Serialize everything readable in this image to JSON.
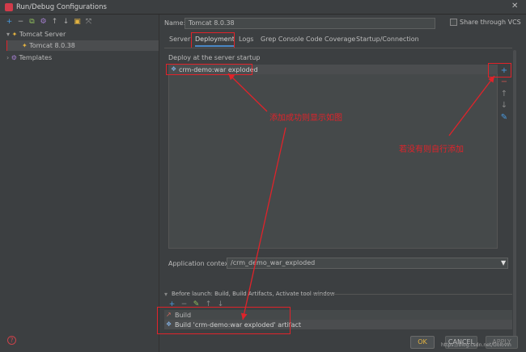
{
  "window": {
    "title": "Run/Debug Configurations",
    "close_glyph": "✕"
  },
  "left_toolbar": [
    "+",
    "−",
    "⧉",
    "⚙",
    "↑",
    "↓",
    "▣",
    "⤧"
  ],
  "tree": {
    "group_label": "Tomcat Server",
    "item_label": "Tomcat 8.0.38",
    "templates_label": "Templates"
  },
  "form": {
    "name_label": "Name:",
    "name_value": "Tomcat 8.0.38",
    "share_label": "Share through VCS"
  },
  "tabs": [
    "Server",
    "Deployment",
    "Logs",
    "Grep Console",
    "Code Coverage",
    "Startup/Connection"
  ],
  "deployment": {
    "section_label": "Deploy at the server startup",
    "artifact": "crm-demo:war exploded",
    "app_context_label": "Application context:",
    "app_context_value": "/crm_demo_war_exploded"
  },
  "side_buttons": [
    "+",
    "−",
    "↑",
    "↓",
    "✎"
  ],
  "before_launch": {
    "label": "Before launch: Build, Build Artifacts, Activate tool window",
    "toolbar": [
      "+",
      "−",
      "✎",
      "↑",
      "↓"
    ],
    "items": [
      "Build",
      "Build 'crm-demo:war exploded' artifact"
    ]
  },
  "annotations": {
    "center": "添加成功则显示如图",
    "right": "若没有则自行添加"
  },
  "buttons": {
    "ok": "OK",
    "cancel": "CANCEL",
    "apply": "APPLY"
  },
  "help_glyph": "?",
  "watermark": "https://blog.csdn.net/Golovin",
  "colors": {
    "accent": "#4a88c7",
    "annotation_red": "#e0232a",
    "ok_text": "#e3b341"
  }
}
